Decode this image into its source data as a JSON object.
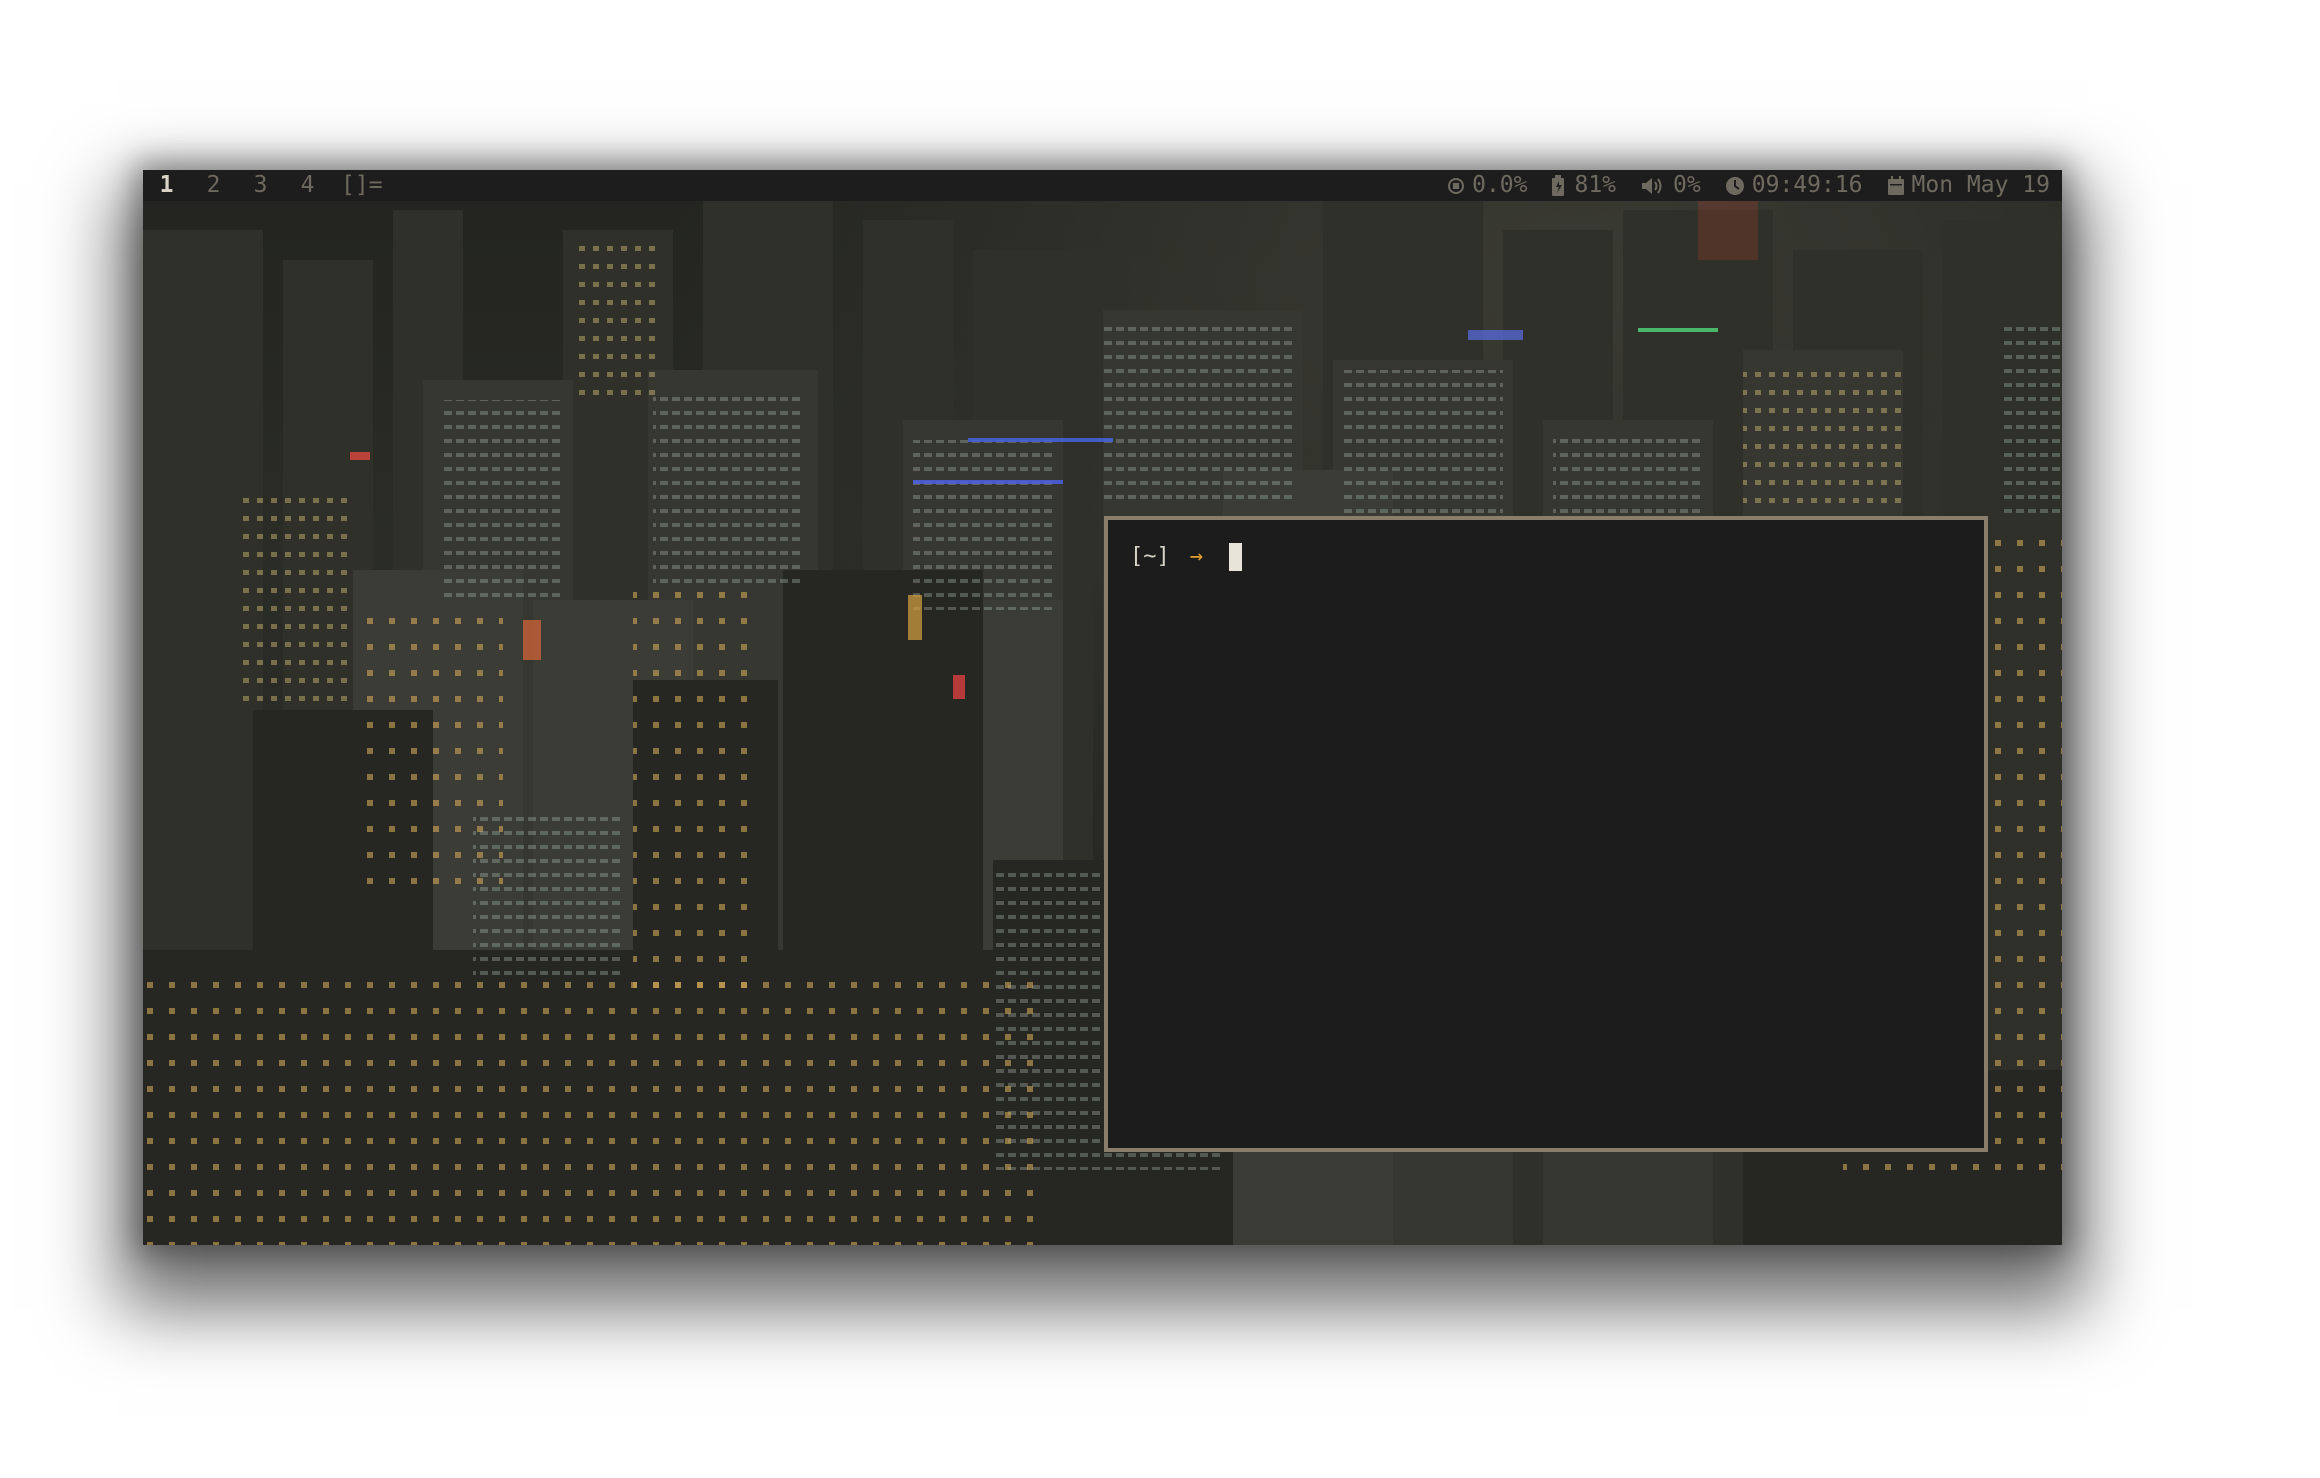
{
  "topbar": {
    "tags": [
      {
        "label": "1",
        "active": true
      },
      {
        "label": "2",
        "active": false
      },
      {
        "label": "3",
        "active": false
      },
      {
        "label": "4",
        "active": false
      }
    ],
    "layout_symbol": "[]=",
    "cpu": {
      "icon": "cpu-icon",
      "value": "0.0%"
    },
    "battery": {
      "icon": "battery-charging-icon",
      "value": "81%"
    },
    "volume": {
      "icon": "volume-icon",
      "value": "0%"
    },
    "clock": {
      "icon": "clock-icon",
      "value": "09:49:16"
    },
    "date": {
      "icon": "calendar-icon",
      "value": "Mon May 19"
    }
  },
  "terminal": {
    "prompt_dir": "[~]",
    "prompt_arrow": "→"
  },
  "colors": {
    "bar_bg": "#1d1d1d",
    "bar_fg": "#6f6a5f",
    "active_tag": "#d8d2c4",
    "terminal_bg": "#1c1c1c",
    "terminal_border": "#8a7d6a",
    "prompt_arrow": "#e0a030"
  }
}
